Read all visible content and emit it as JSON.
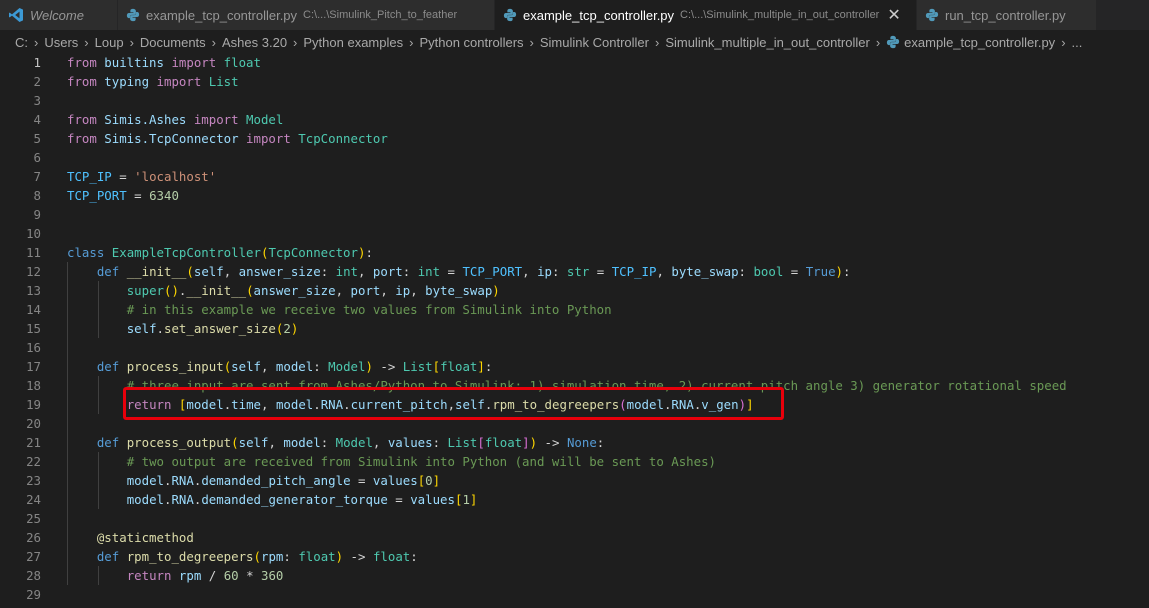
{
  "tabs": [
    {
      "name": "Welcome",
      "desc": ""
    },
    {
      "name": "example_tcp_controller.py",
      "desc": "C:\\...\\Simulink_Pitch_to_feather"
    },
    {
      "name": "example_tcp_controller.py",
      "desc": "C:\\...\\Simulink_multiple_in_out_controller",
      "close": "✕"
    },
    {
      "name": "run_tcp_controller.py",
      "desc": ""
    }
  ],
  "breadcrumb": [
    "C:",
    "Users",
    "Loup",
    "Documents",
    "Ashes 3.20",
    "Python examples",
    "Python controllers",
    "Simulink Controller",
    "Simulink_multiple_in_out_controller",
    "example_tcp_controller.py",
    "..."
  ],
  "code": [
    {
      "n": "1",
      "t": [
        [
          "from",
          "k"
        ],
        [
          " builtins ",
          "v"
        ],
        [
          "import",
          "k"
        ],
        [
          " float",
          "t"
        ]
      ]
    },
    {
      "n": "2",
      "t": [
        [
          "from",
          "k"
        ],
        [
          " typing ",
          "v"
        ],
        [
          "import",
          "k"
        ],
        [
          " List",
          "t"
        ]
      ]
    },
    {
      "n": "3",
      "t": []
    },
    {
      "n": "4",
      "t": [
        [
          "from",
          "k"
        ],
        [
          " Simis.Ashes ",
          "v"
        ],
        [
          "import",
          "k"
        ],
        [
          " Model",
          "t"
        ]
      ]
    },
    {
      "n": "5",
      "t": [
        [
          "from",
          "k"
        ],
        [
          " Simis.TcpConnector ",
          "v"
        ],
        [
          "import",
          "k"
        ],
        [
          " TcpConnector",
          "t"
        ]
      ]
    },
    {
      "n": "6",
      "t": []
    },
    {
      "n": "7",
      "t": [
        [
          "TCP_IP",
          "cn"
        ],
        [
          " = ",
          "p"
        ],
        [
          "'localhost'",
          "s"
        ]
      ]
    },
    {
      "n": "8",
      "t": [
        [
          "TCP_PORT",
          "cn"
        ],
        [
          " = ",
          "p"
        ],
        [
          "6340",
          "n"
        ]
      ]
    },
    {
      "n": "9",
      "t": []
    },
    {
      "n": "10",
      "t": []
    },
    {
      "n": "11",
      "t": [
        [
          "class",
          "b"
        ],
        [
          " ",
          "p"
        ],
        [
          "ExampleTcpController",
          "t"
        ],
        [
          "(",
          "br1"
        ],
        [
          "TcpConnector",
          "t"
        ],
        [
          ")",
          "br1"
        ],
        [
          ":",
          "p"
        ]
      ]
    },
    {
      "n": "12",
      "t": [
        [
          "    ",
          "p"
        ],
        [
          "def",
          "b"
        ],
        [
          " ",
          "p"
        ],
        [
          "__init__",
          "f"
        ],
        [
          "(",
          "br1"
        ],
        [
          "self",
          "v"
        ],
        [
          ", ",
          "p"
        ],
        [
          "answer_size",
          "v"
        ],
        [
          ": ",
          "p"
        ],
        [
          "int",
          "t"
        ],
        [
          ", ",
          "p"
        ],
        [
          "port",
          "v"
        ],
        [
          ": ",
          "p"
        ],
        [
          "int",
          "t"
        ],
        [
          " = ",
          "p"
        ],
        [
          "TCP_PORT",
          "cn"
        ],
        [
          ", ",
          "p"
        ],
        [
          "ip",
          "v"
        ],
        [
          ": ",
          "p"
        ],
        [
          "str",
          "t"
        ],
        [
          " = ",
          "p"
        ],
        [
          "TCP_IP",
          "cn"
        ],
        [
          ", ",
          "p"
        ],
        [
          "byte_swap",
          "v"
        ],
        [
          ": ",
          "p"
        ],
        [
          "bool",
          "t"
        ],
        [
          " = ",
          "p"
        ],
        [
          "True",
          "b"
        ],
        [
          ")",
          "br1"
        ],
        [
          ":",
          "p"
        ]
      ]
    },
    {
      "n": "13",
      "t": [
        [
          "        ",
          "p"
        ],
        [
          "super",
          "t"
        ],
        [
          "()",
          "br1"
        ],
        [
          ".",
          "p"
        ],
        [
          "__init__",
          "f"
        ],
        [
          "(",
          "br1"
        ],
        [
          "answer_size",
          "v"
        ],
        [
          ", ",
          "p"
        ],
        [
          "port",
          "v"
        ],
        [
          ", ",
          "p"
        ],
        [
          "ip",
          "v"
        ],
        [
          ", ",
          "p"
        ],
        [
          "byte_swap",
          "v"
        ],
        [
          ")",
          "br1"
        ]
      ]
    },
    {
      "n": "14",
      "t": [
        [
          "        ",
          "p"
        ],
        [
          "# in this example we receive two values from Simulink into Python",
          "c"
        ]
      ]
    },
    {
      "n": "15",
      "t": [
        [
          "        ",
          "p"
        ],
        [
          "self",
          "v"
        ],
        [
          ".",
          "p"
        ],
        [
          "set_answer_size",
          "f"
        ],
        [
          "(",
          "br1"
        ],
        [
          "2",
          "n"
        ],
        [
          ")",
          "br1"
        ]
      ]
    },
    {
      "n": "16",
      "t": []
    },
    {
      "n": "17",
      "t": [
        [
          "    ",
          "p"
        ],
        [
          "def",
          "b"
        ],
        [
          " ",
          "p"
        ],
        [
          "process_input",
          "f"
        ],
        [
          "(",
          "br1"
        ],
        [
          "self",
          "v"
        ],
        [
          ", ",
          "p"
        ],
        [
          "model",
          "v"
        ],
        [
          ": ",
          "p"
        ],
        [
          "Model",
          "t"
        ],
        [
          ")",
          "br1"
        ],
        [
          " -> ",
          "p"
        ],
        [
          "List",
          "t"
        ],
        [
          "[",
          "br1"
        ],
        [
          "float",
          "t"
        ],
        [
          "]",
          "br1"
        ],
        [
          ":",
          "p"
        ]
      ]
    },
    {
      "n": "18",
      "t": [
        [
          "        ",
          "p"
        ],
        [
          "# three input are sent from Ashes/Python to Simulink: 1) simulation time, 2) current pitch angle 3) generator rotational speed",
          "c"
        ]
      ]
    },
    {
      "n": "19",
      "t": [
        [
          "        ",
          "p"
        ],
        [
          "return",
          "k"
        ],
        [
          " ",
          "p"
        ],
        [
          "[",
          "br1"
        ],
        [
          "model",
          "v"
        ],
        [
          ".",
          "p"
        ],
        [
          "time",
          "v"
        ],
        [
          ", ",
          "p"
        ],
        [
          "model",
          "v"
        ],
        [
          ".",
          "p"
        ],
        [
          "RNA",
          "v"
        ],
        [
          ".",
          "p"
        ],
        [
          "current_pitch",
          "v"
        ],
        [
          ",",
          "p"
        ],
        [
          "self",
          "v"
        ],
        [
          ".",
          "p"
        ],
        [
          "rpm_to_degreepers",
          "f"
        ],
        [
          "(",
          "br2"
        ],
        [
          "model",
          "v"
        ],
        [
          ".",
          "p"
        ],
        [
          "RNA",
          "v"
        ],
        [
          ".",
          "p"
        ],
        [
          "v_gen",
          "v"
        ],
        [
          ")",
          "br2"
        ],
        [
          "]",
          "br1"
        ]
      ]
    },
    {
      "n": "20",
      "t": []
    },
    {
      "n": "21",
      "t": [
        [
          "    ",
          "p"
        ],
        [
          "def",
          "b"
        ],
        [
          " ",
          "p"
        ],
        [
          "process_output",
          "f"
        ],
        [
          "(",
          "br1"
        ],
        [
          "self",
          "v"
        ],
        [
          ", ",
          "p"
        ],
        [
          "model",
          "v"
        ],
        [
          ": ",
          "p"
        ],
        [
          "Model",
          "t"
        ],
        [
          ", ",
          "p"
        ],
        [
          "values",
          "v"
        ],
        [
          ": ",
          "p"
        ],
        [
          "List",
          "t"
        ],
        [
          "[",
          "br2"
        ],
        [
          "float",
          "t"
        ],
        [
          "]",
          "br2"
        ],
        [
          ")",
          "br1"
        ],
        [
          " -> ",
          "p"
        ],
        [
          "None",
          "b"
        ],
        [
          ":",
          "p"
        ]
      ]
    },
    {
      "n": "22",
      "t": [
        [
          "        ",
          "p"
        ],
        [
          "# two output are received from Simulink into Python (and will be sent to Ashes)",
          "c"
        ]
      ]
    },
    {
      "n": "23",
      "t": [
        [
          "        ",
          "p"
        ],
        [
          "model",
          "v"
        ],
        [
          ".",
          "p"
        ],
        [
          "RNA",
          "v"
        ],
        [
          ".",
          "p"
        ],
        [
          "demanded_pitch_angle",
          "v"
        ],
        [
          " = ",
          "p"
        ],
        [
          "values",
          "v"
        ],
        [
          "[",
          "br1"
        ],
        [
          "0",
          "n"
        ],
        [
          "]",
          "br1"
        ]
      ]
    },
    {
      "n": "24",
      "t": [
        [
          "        ",
          "p"
        ],
        [
          "model",
          "v"
        ],
        [
          ".",
          "p"
        ],
        [
          "RNA",
          "v"
        ],
        [
          ".",
          "p"
        ],
        [
          "demanded_generator_torque",
          "v"
        ],
        [
          " = ",
          "p"
        ],
        [
          "values",
          "v"
        ],
        [
          "[",
          "br1"
        ],
        [
          "1",
          "n"
        ],
        [
          "]",
          "br1"
        ]
      ]
    },
    {
      "n": "25",
      "t": []
    },
    {
      "n": "26",
      "t": [
        [
          "    ",
          "p"
        ],
        [
          "@staticmethod",
          "f"
        ]
      ]
    },
    {
      "n": "27",
      "t": [
        [
          "    ",
          "p"
        ],
        [
          "def",
          "b"
        ],
        [
          " ",
          "p"
        ],
        [
          "rpm_to_degreepers",
          "f"
        ],
        [
          "(",
          "br1"
        ],
        [
          "rpm",
          "v"
        ],
        [
          ": ",
          "p"
        ],
        [
          "float",
          "t"
        ],
        [
          ")",
          "br1"
        ],
        [
          " -> ",
          "p"
        ],
        [
          "float",
          "t"
        ],
        [
          ":",
          "p"
        ]
      ]
    },
    {
      "n": "28",
      "t": [
        [
          "        ",
          "p"
        ],
        [
          "return",
          "k"
        ],
        [
          " ",
          "p"
        ],
        [
          "rpm",
          "v"
        ],
        [
          " / ",
          "p"
        ],
        [
          "60",
          "n"
        ],
        [
          " * ",
          "p"
        ],
        [
          "360",
          "n"
        ]
      ]
    },
    {
      "n": "29",
      "t": []
    }
  ]
}
